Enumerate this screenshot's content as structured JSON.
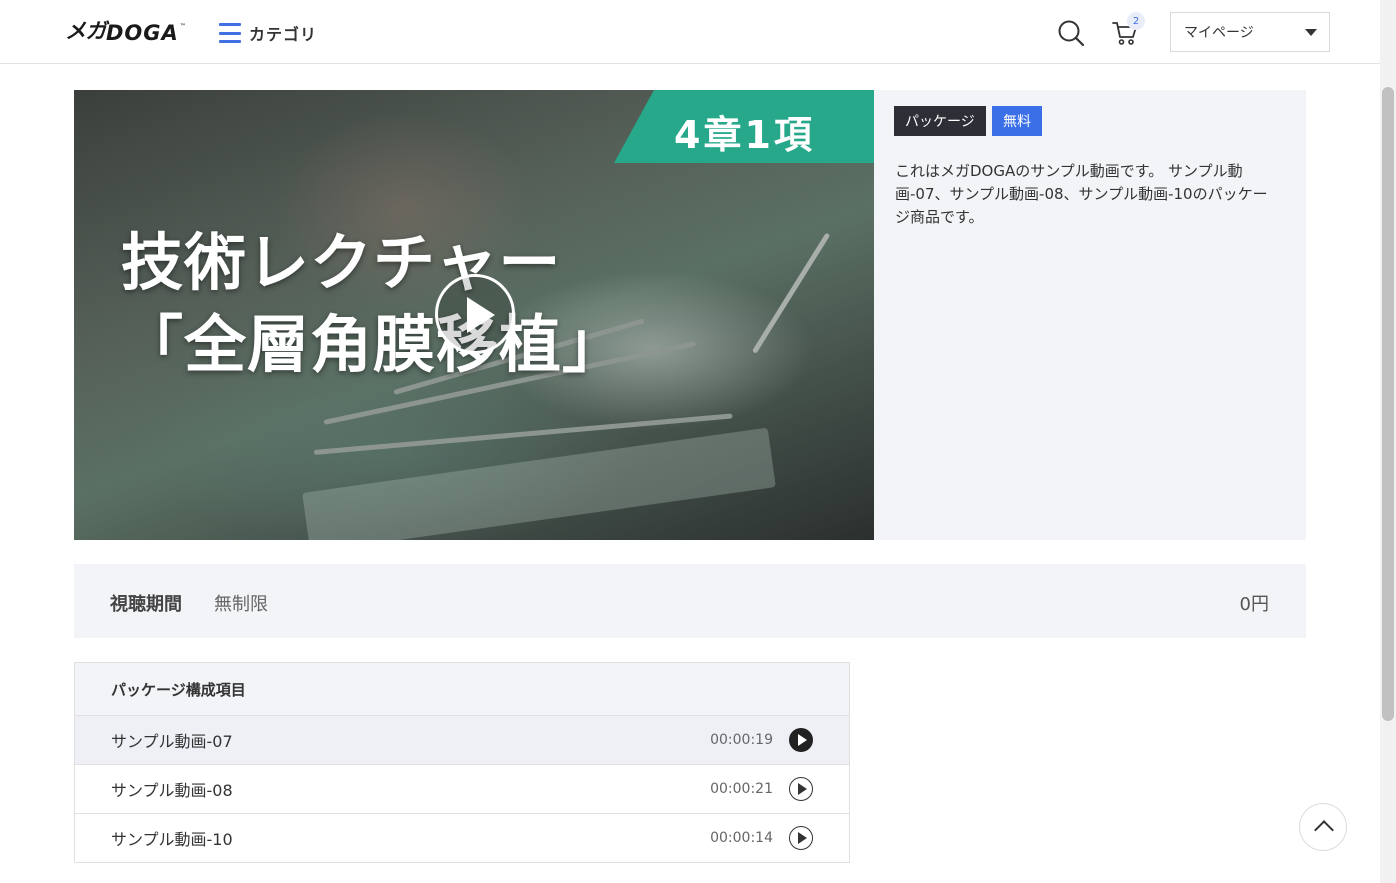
{
  "header": {
    "logo": {
      "katakana": "メガ",
      "latin": "DOGA",
      "tm": "™"
    },
    "category_label": "カテゴリ",
    "cart_count": "2",
    "mypage_label": "マイページ"
  },
  "hero": {
    "banner": "4章1項",
    "title_line1": "技術レクチャー",
    "title_line2": "「全層角膜移植」"
  },
  "product": {
    "tags": {
      "package": "パッケージ",
      "free": "無料"
    },
    "description": "これはメガDOGAのサンプル動画です。 サンプル動画-07、サンプル動画-08、サンプル動画-10のパッケージ商品です。"
  },
  "pricing": {
    "period_label": "視聴期間",
    "period_value": "無制限",
    "price": "0円"
  },
  "package": {
    "heading": "パッケージ構成項目",
    "items": [
      {
        "name": "サンプル動画-07",
        "duration": "00:00:19",
        "active": true
      },
      {
        "name": "サンプル動画-08",
        "duration": "00:00:21",
        "active": false
      },
      {
        "name": "サンプル動画-10",
        "duration": "00:00:14",
        "active": false
      }
    ]
  },
  "colors": {
    "accent": "#3b6fe8",
    "banner_green": "#27a88a",
    "panel_bg": "#f3f4f8",
    "dark_tag": "#2e2f36"
  }
}
